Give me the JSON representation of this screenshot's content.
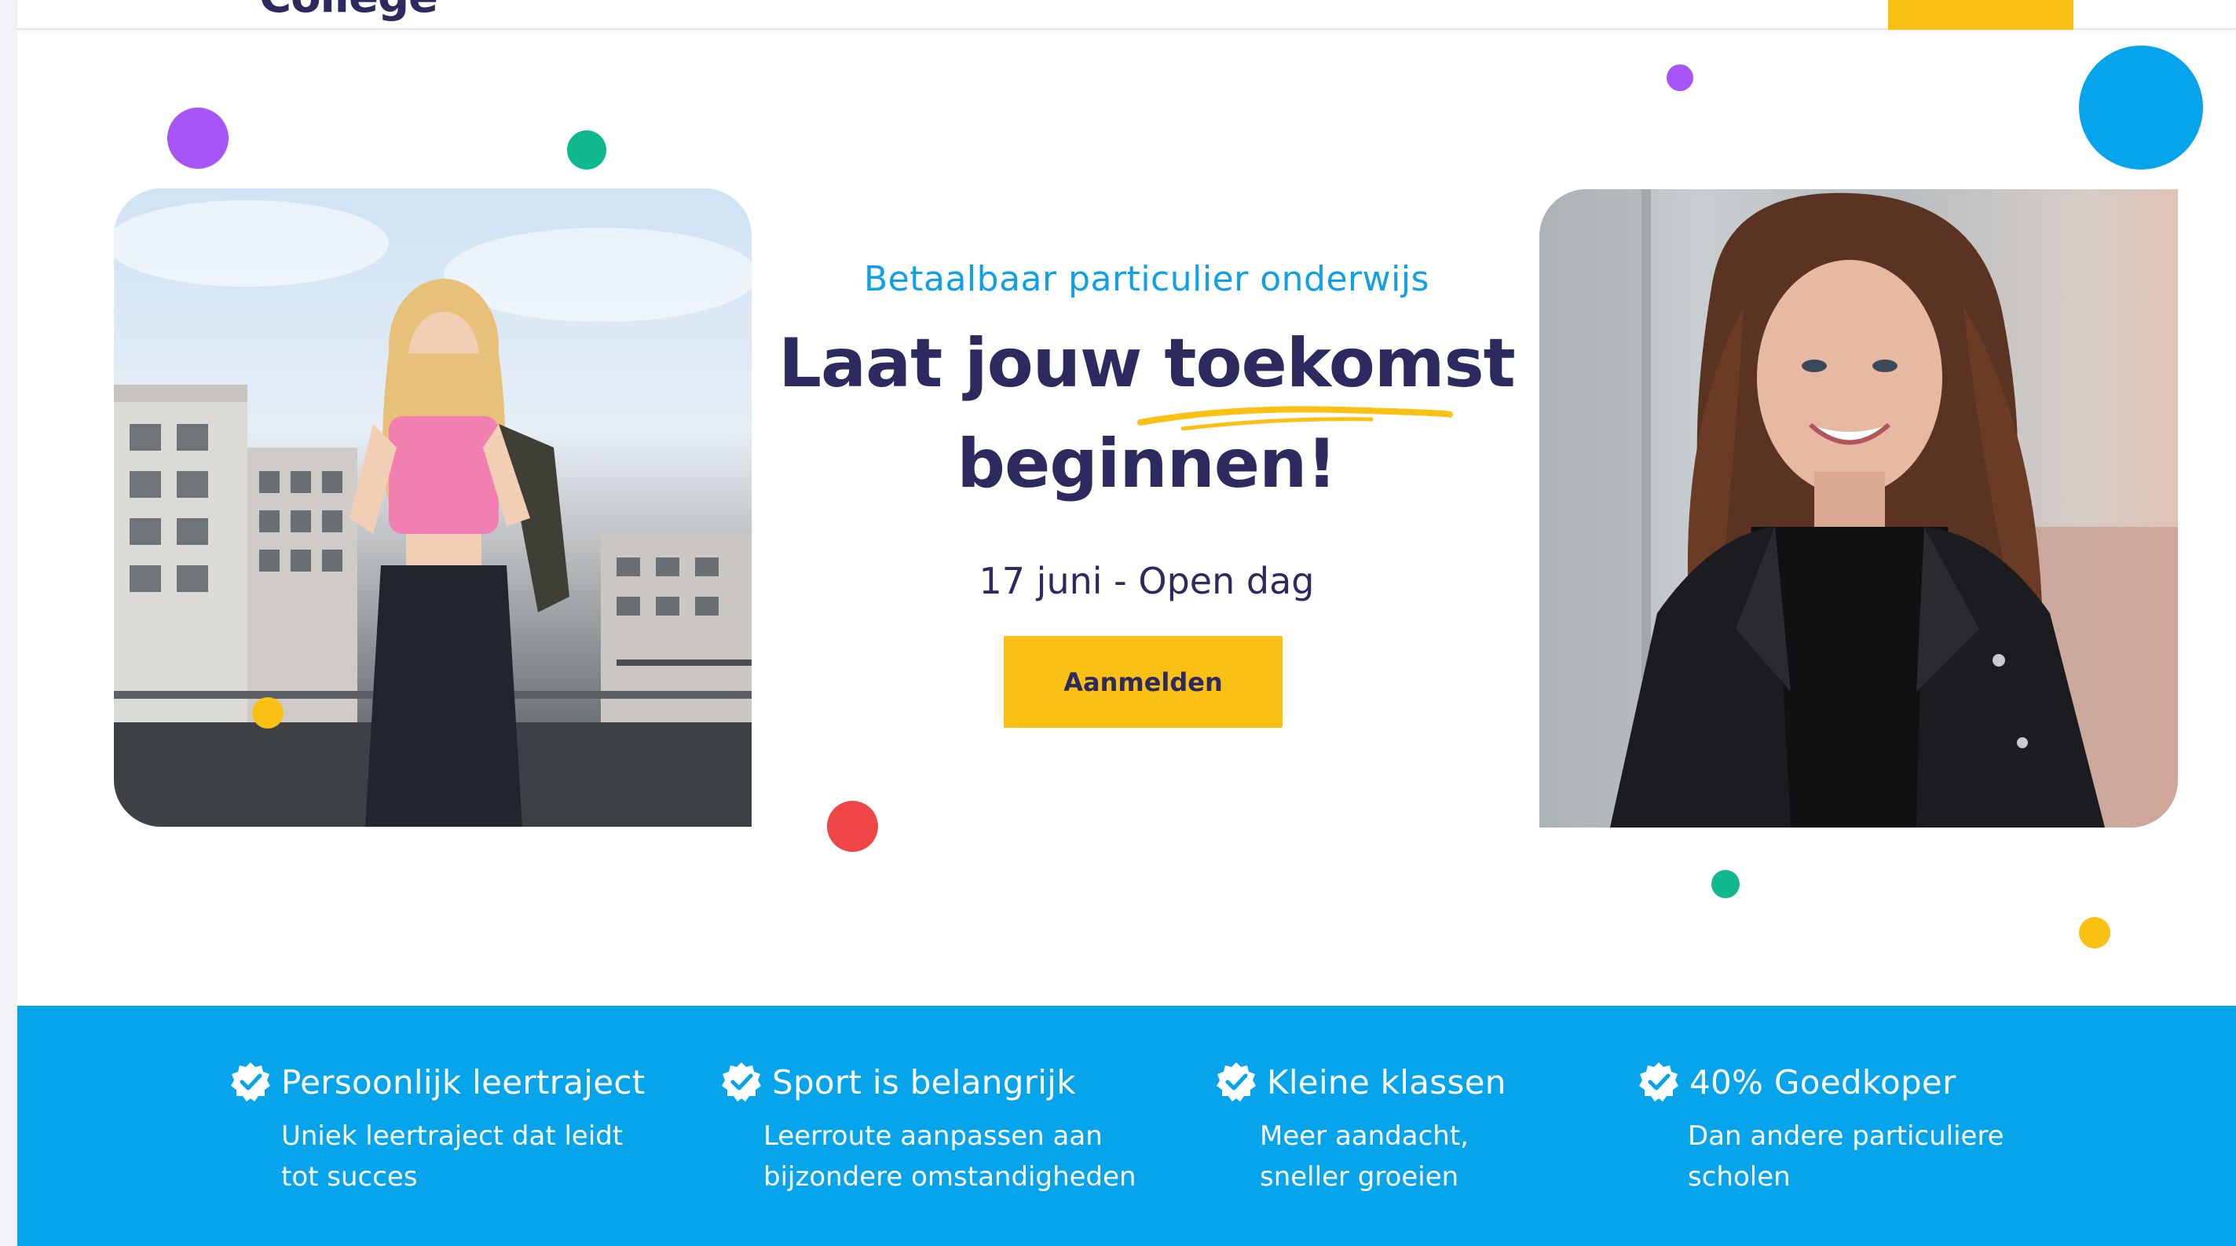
{
  "header": {
    "logo_text": "College",
    "cta_color": "#fbc014"
  },
  "hero": {
    "eyebrow": "Betaalbaar particulier onderwijs",
    "title_line1": "Laat jouw toekomst",
    "title_line2": "beginnen!",
    "date_text": "17 juni - Open dag",
    "cta_label": "Aanmelden",
    "left_photo_icon": "student-photo-pink-top",
    "right_photo_icon": "student-photo-leather-jacket"
  },
  "features": [
    {
      "icon": "verified-badge-icon",
      "title": "Persoonlijk leertraject",
      "desc_line1": "Uniek leertraject dat leidt",
      "desc_line2": "tot succes"
    },
    {
      "icon": "verified-badge-icon",
      "title": "Sport is belangrijk",
      "desc_line1": "Leerroute aanpassen aan",
      "desc_line2": "bijzondere omstandigheden"
    },
    {
      "icon": "verified-badge-icon",
      "title": "Kleine klassen",
      "desc_line1": "Meer aandacht,",
      "desc_line2": "sneller groeien"
    },
    {
      "icon": "verified-badge-icon",
      "title": "40% Goedkoper",
      "desc_line1": "Dan andere particuliere",
      "desc_line2": "scholen"
    }
  ],
  "colors": {
    "navy": "#2c2a5e",
    "accent_blue": "#06a4ea",
    "yellow": "#fbc014",
    "purple": "#a855f7",
    "green": "#10b98d",
    "red": "#ef4747"
  }
}
